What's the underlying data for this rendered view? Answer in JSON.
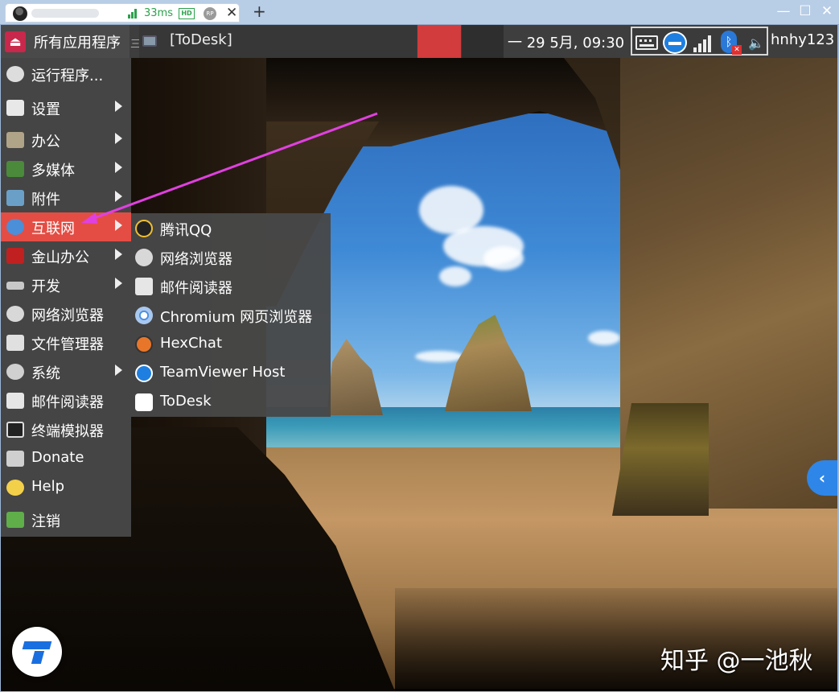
{
  "remote_bar": {
    "latency": "33ms",
    "hd_label": "HD",
    "rp_label": "RP",
    "close_glyph": "✕",
    "new_tab_glyph": "+",
    "win_controls": [
      "—",
      "☐",
      "✕"
    ]
  },
  "panel": {
    "apps_menu_label": "所有应用程序",
    "separator": "三",
    "task_label": "[ToDesk]",
    "clock": "一 29 5月, 09:30",
    "user": "hnhy123"
  },
  "main_menu": {
    "items": [
      {
        "label": "运行程序...",
        "icon": "run-icon",
        "submenu": false
      },
      {
        "label": "设置",
        "icon": "settings-icon",
        "submenu": true
      },
      {
        "label": "办公",
        "icon": "office-icon",
        "submenu": true
      },
      {
        "label": "多媒体",
        "icon": "multimedia-icon",
        "submenu": true
      },
      {
        "label": "附件",
        "icon": "accessories-icon",
        "submenu": true
      },
      {
        "label": "互联网",
        "icon": "internet-icon",
        "submenu": true,
        "active": true
      },
      {
        "label": "金山办公",
        "icon": "wps-icon",
        "submenu": true
      },
      {
        "label": "开发",
        "icon": "development-icon",
        "submenu": true
      },
      {
        "label": "网络浏览器",
        "icon": "browser-icon",
        "submenu": false
      },
      {
        "label": "文件管理器",
        "icon": "file-manager-icon",
        "submenu": false
      },
      {
        "label": "系统",
        "icon": "system-icon",
        "submenu": true
      },
      {
        "label": "邮件阅读器",
        "icon": "mail-icon",
        "submenu": false
      },
      {
        "label": "终端模拟器",
        "icon": "terminal-icon",
        "submenu": false
      },
      {
        "label": "Donate",
        "icon": "donate-icon",
        "submenu": false
      },
      {
        "label": "Help",
        "icon": "help-icon",
        "submenu": false
      },
      {
        "label": "注销",
        "icon": "logout-icon",
        "submenu": false
      }
    ]
  },
  "internet_submenu": {
    "items": [
      {
        "label": "腾讯QQ",
        "icon": "qq-icon"
      },
      {
        "label": "网络浏览器",
        "icon": "browser-icon"
      },
      {
        "label": "邮件阅读器",
        "icon": "mail-icon"
      },
      {
        "label": "Chromium 网页浏览器",
        "icon": "chromium-icon"
      },
      {
        "label": "HexChat",
        "icon": "hexchat-icon"
      },
      {
        "label": "TeamViewer Host",
        "icon": "teamviewer-icon"
      },
      {
        "label": "ToDesk",
        "icon": "todesk-icon"
      }
    ]
  },
  "side_button_glyph": "‹",
  "watermark": "知乎 @一池秋",
  "colors": {
    "menu_bg": "#484848",
    "active_item": "#e44d44",
    "arrow": "#e040e0",
    "accent_blue": "#2e86e8"
  }
}
